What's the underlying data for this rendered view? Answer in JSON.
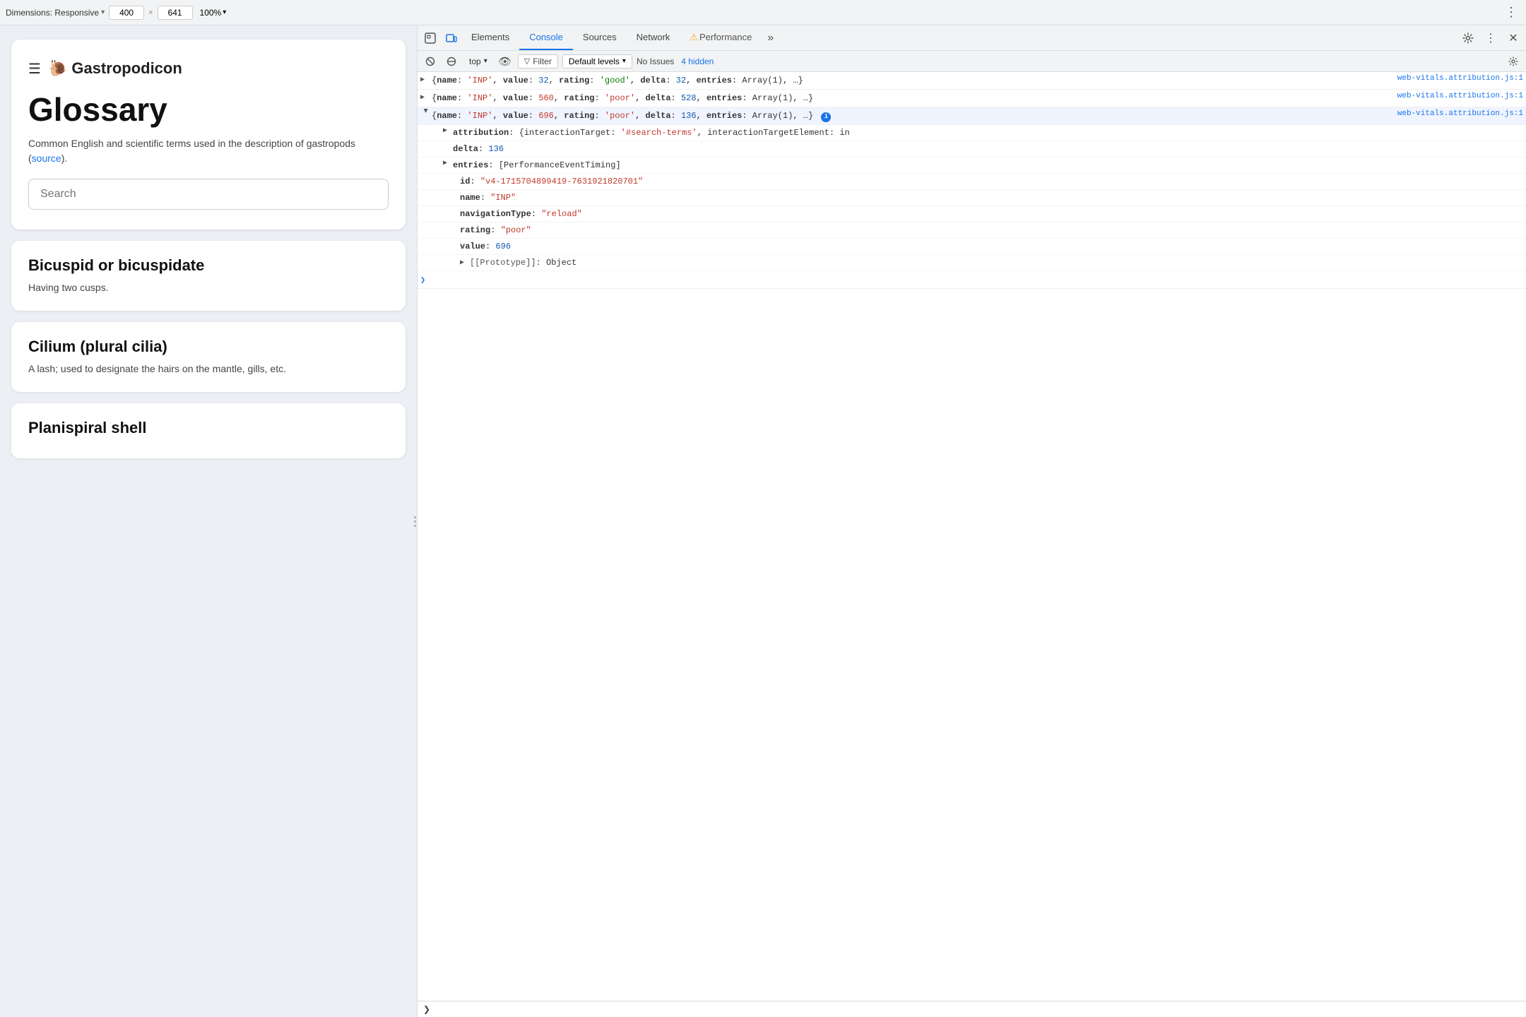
{
  "topbar": {
    "dimensions_label": "Dimensions: Responsive",
    "width": "400",
    "height": "641",
    "zoom": "100%",
    "dots_label": "⋮"
  },
  "website": {
    "site_name": "Gastropodicon",
    "glossary_title": "Glossary",
    "glossary_desc": "Common English and scientific terms used in the description of gastropods (",
    "source_link": "source",
    "source_link_suffix": ").",
    "search_placeholder": "Search",
    "entries": [
      {
        "term": "Bicuspid or bicuspidate",
        "definition": "Having two cusps."
      },
      {
        "term": "Cilium (plural cilia)",
        "definition": "A lash; used to designate the hairs on the mantle, gills, etc."
      },
      {
        "term": "Planispiral shell",
        "definition": ""
      }
    ]
  },
  "devtools": {
    "tabs": [
      {
        "label": "Elements",
        "active": false
      },
      {
        "label": "Console",
        "active": true
      },
      {
        "label": "Sources",
        "active": false
      },
      {
        "label": "Network",
        "active": false
      },
      {
        "label": "Performance",
        "active": false,
        "warning": true
      }
    ],
    "more_tabs": "»",
    "context": "top",
    "filter_label": "Filter",
    "level_label": "Default levels",
    "no_issues": "No Issues",
    "hidden_count": "4 hidden"
  },
  "console": {
    "entries": [
      {
        "id": "entry1",
        "expanded": false,
        "link": "web-vitals.attribution.js:1",
        "text": "{name: 'INP', value: 32, rating: 'good', delta: 32, entries: Array(1), …}"
      },
      {
        "id": "entry2",
        "expanded": false,
        "link": "web-vitals.attribution.js:1",
        "text": "{name: 'INP', value: 560, rating: 'poor', delta: 528, entries: Array(1), …}"
      },
      {
        "id": "entry3",
        "expanded": true,
        "link": "web-vitals.attribution.js:1",
        "text": "{name: 'INP', value: 696, rating: 'poor', delta: 136, entries: Array(1), …}",
        "children": [
          {
            "id": "child-attribution",
            "expanded": false,
            "text": "attribution: {interactionTarget: '#search-terms', interactionTargetElement: in",
            "indent": 36
          },
          {
            "id": "child-delta",
            "expanded": false,
            "text": "delta: 136",
            "indent": 36,
            "no_toggle": true
          },
          {
            "id": "child-entries",
            "expanded": false,
            "text": "entries: [PerformanceEventTiming]",
            "indent": 36
          },
          {
            "id": "child-id",
            "text": "id: \"v4-1715704899419-7631921820701\"",
            "indent": 60,
            "no_toggle": true
          },
          {
            "id": "child-name",
            "text": "name: \"INP\"",
            "indent": 60,
            "no_toggle": true
          },
          {
            "id": "child-navtype",
            "text": "navigationType: \"reload\"",
            "indent": 60,
            "no_toggle": true
          },
          {
            "id": "child-rating",
            "text": "rating: \"poor\"",
            "indent": 60,
            "no_toggle": true
          },
          {
            "id": "child-value",
            "text": "value: 696",
            "indent": 60,
            "no_toggle": true
          },
          {
            "id": "child-proto",
            "expanded": false,
            "text": "[[Prototype]]: Object",
            "indent": 60
          }
        ]
      }
    ],
    "input_placeholder": ""
  }
}
